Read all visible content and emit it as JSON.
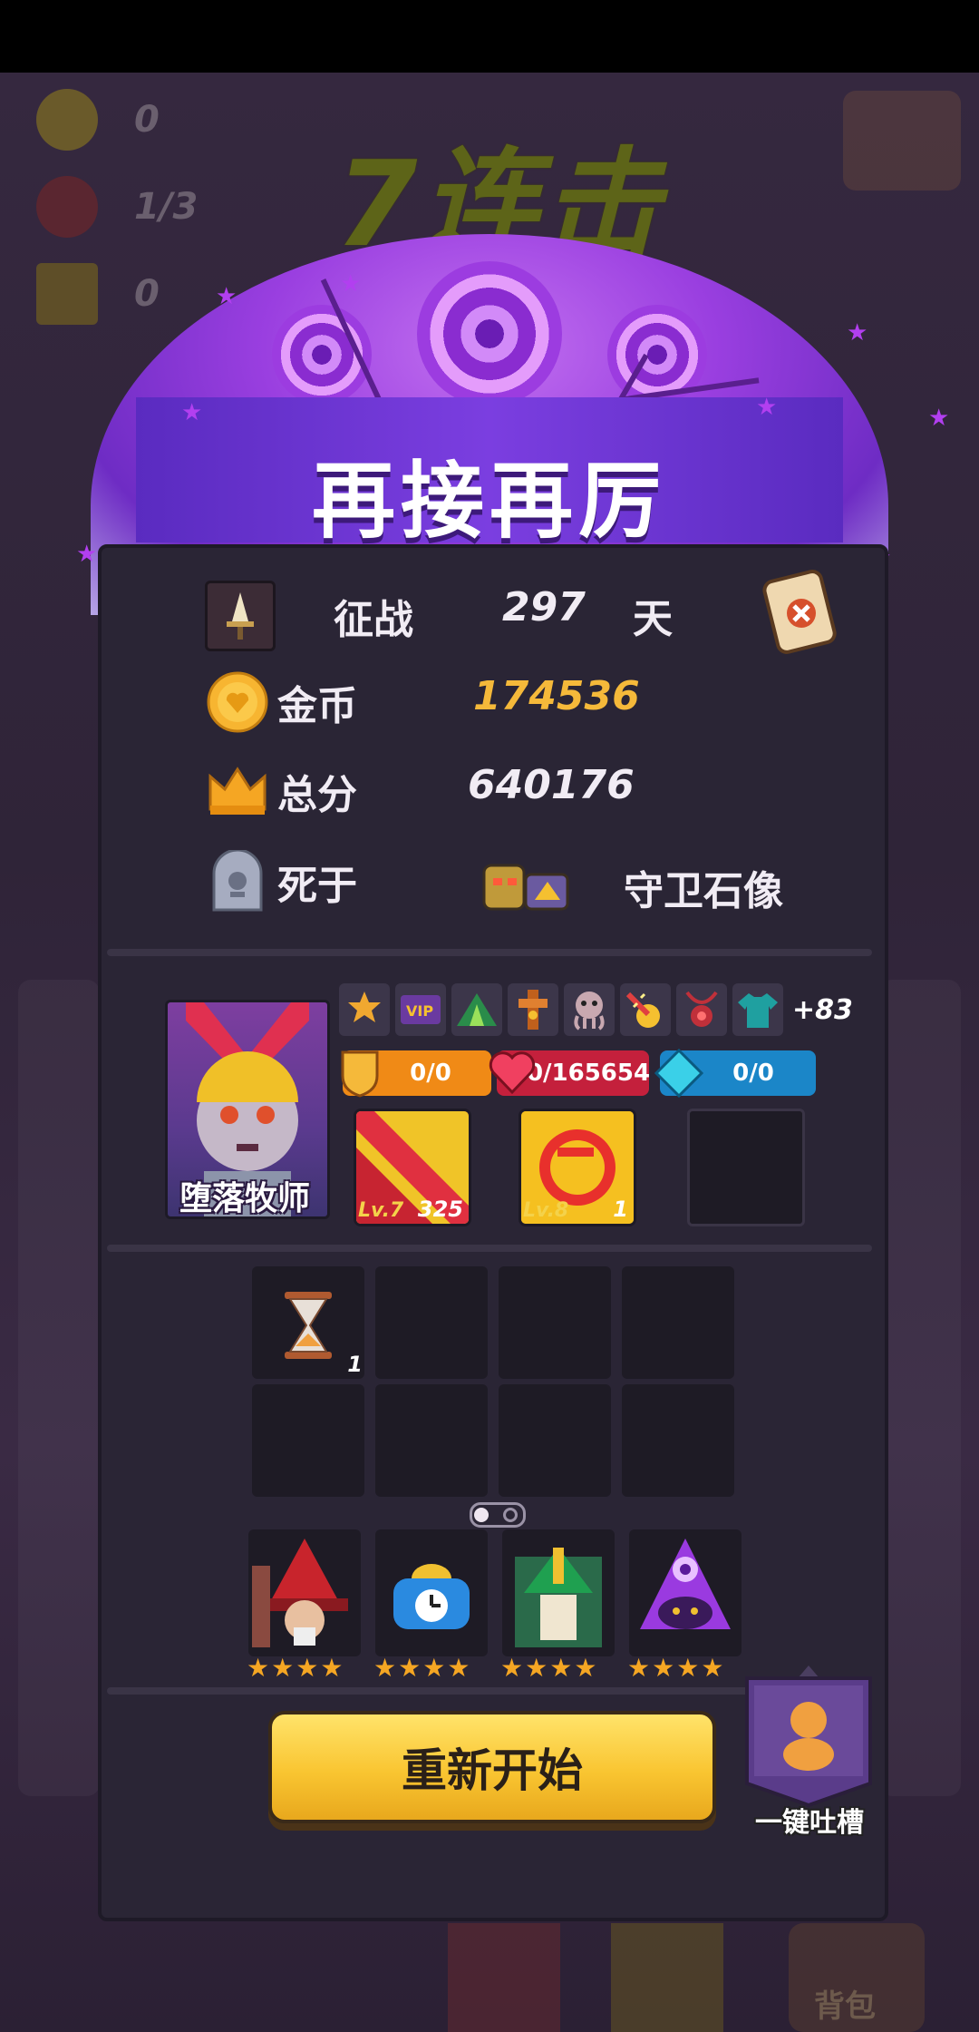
{
  "hud": {
    "hearts": "0",
    "demons": "1/3",
    "crowns": "0"
  },
  "combo_text": "7连击",
  "dialog": {
    "title": "再接再厉",
    "stats": {
      "days_label": "征战",
      "days_value": "297",
      "days_unit": "天",
      "gold_label": "金币",
      "gold_value": "174536",
      "score_label": "总分",
      "score_value": "640176",
      "died_label": "死于",
      "killer_name": "守卫石像"
    },
    "hero": {
      "name": "堕落牧师",
      "relic_icons": [
        "sheriff-badge-icon",
        "vip-card-icon",
        "tent-icon",
        "totem-icon",
        "octopus-icon",
        "fire-cannon-icon",
        "amulet-icon",
        "green-shirt-icon"
      ],
      "relic_more": "+83",
      "shield_text": "0/0",
      "hp_text": "0/165654",
      "mana_text": "0/0"
    },
    "items": [
      {
        "icon": "red-rod-icon",
        "level": "Lv.7",
        "count": "325"
      },
      {
        "icon": "yellow-mask-icon",
        "level": "Lv.8",
        "count": "1"
      }
    ],
    "inventory_count": "1",
    "characters": [
      {
        "icon": "red-wizard-icon",
        "stars": 4
      },
      {
        "icon": "blue-clock-icon",
        "stars": 4
      },
      {
        "icon": "green-archer-icon",
        "stars": 4
      },
      {
        "icon": "purple-eye-mage-icon",
        "stars": 4
      }
    ],
    "restart_label": "重新开始",
    "feedback_label": "一键吐槽"
  },
  "background": {
    "bag_label": "背包"
  },
  "colors": {
    "gold": "#f5b93a",
    "accent_purple": "#7b3ee0",
    "hp_red": "#c4203c",
    "mana_blue": "#1b86c8",
    "shield_orange": "#f08a16"
  }
}
